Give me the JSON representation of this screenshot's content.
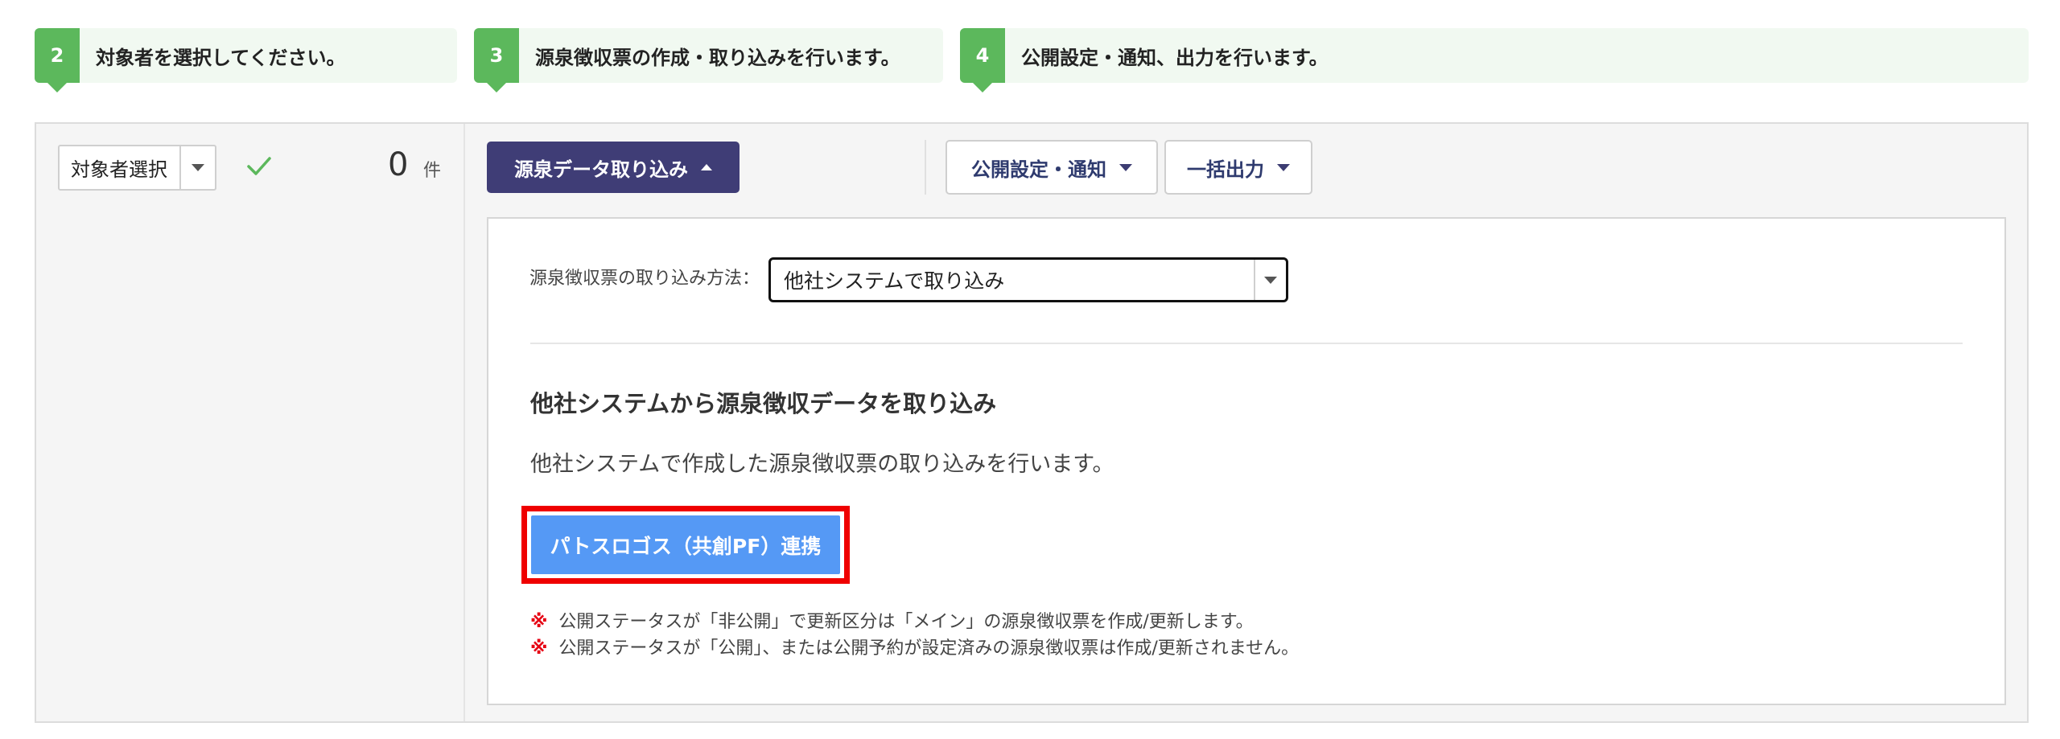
{
  "steps": [
    {
      "number": "2",
      "text": "対象者を選択してください。"
    },
    {
      "number": "3",
      "text": "源泉徴収票の作成・取り込みを行います。"
    },
    {
      "number": "4",
      "text": "公開設定・通知、出力を行います。"
    }
  ],
  "target": {
    "select_label": "対象者選択",
    "count": "0",
    "count_unit": "件"
  },
  "toolbar": {
    "import_label": "源泉データ取り込み",
    "publish_label": "公開設定・通知",
    "export_label": "一括出力"
  },
  "import_panel": {
    "method_label": "源泉徴収票の取り込み方法：",
    "method_value": "他社システムで取り込み",
    "heading": "他社システムから源泉徴収データを取り込み",
    "description": "他社システムで作成した源泉徴収票の取り込みを行います。",
    "pasto_button_label": "パトスロゴス（共創PF）連携",
    "notes": [
      {
        "mark": "※",
        "text": "公開ステータスが「非公開」で更新区分は「メイン」の源泉徴収票を作成/更新します。"
      },
      {
        "mark": "※",
        "text": "公開ステータスが「公開」、または公開予約が設定済みの源泉徴収票は作成/更新されません。"
      }
    ]
  },
  "colors": {
    "step_green": "#5cb85c",
    "import_button": "#3f3d76",
    "pasto_button": "#5599f5",
    "highlight_red": "#ef0000",
    "note_mark": "#e60012"
  }
}
